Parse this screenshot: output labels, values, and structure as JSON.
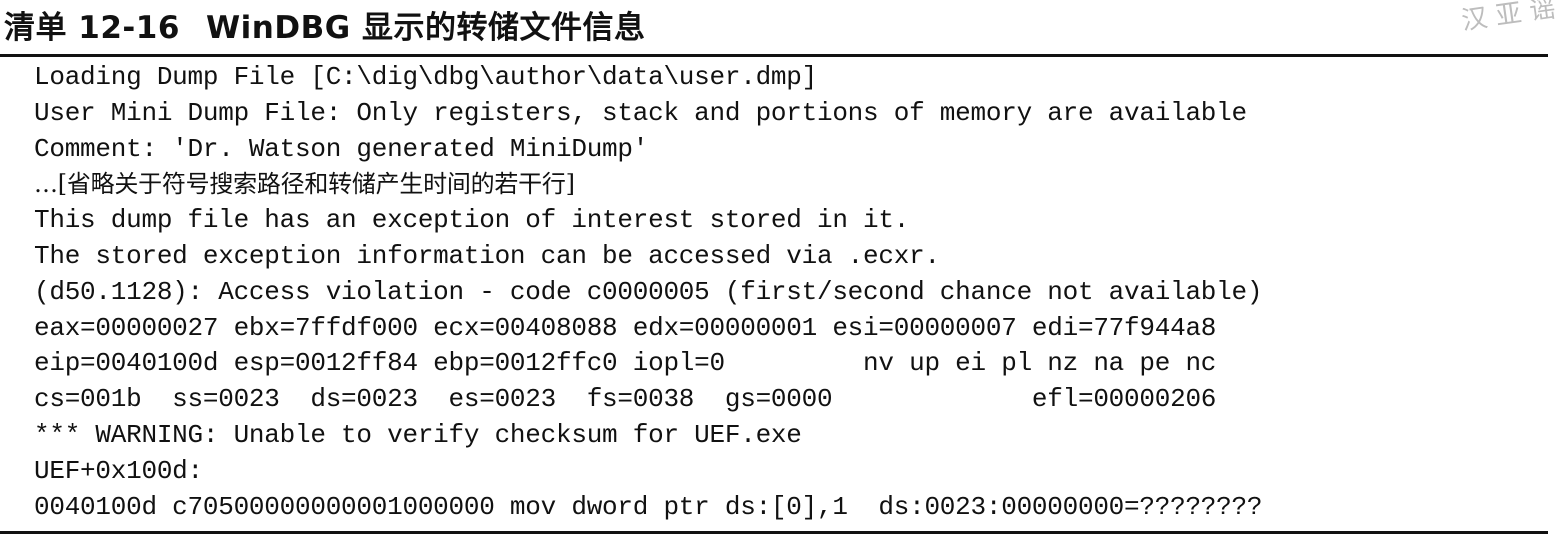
{
  "header": {
    "listing_number": "清单 12-16",
    "listing_caption": "WinDBG 显示的转储文件信息",
    "watermark": "汉 亚 谣"
  },
  "code_lines": [
    "Loading Dump File [C:\\dig\\dbg\\author\\data\\user.dmp]",
    "User Mini Dump File: Only registers, stack and portions of memory are available",
    "Comment: 'Dr. Watson generated MiniDump'",
    "…[省略关于符号搜索路径和转储产生时间的若干行]",
    "This dump file has an exception of interest stored in it.",
    "The stored exception information can be accessed via .ecxr.",
    "(d50.1128): Access violation - code c0000005 (first/second chance not available)",
    "eax=00000027 ebx=7ffdf000 ecx=00408088 edx=00000001 esi=00000007 edi=77f944a8",
    "eip=0040100d esp=0012ff84 ebp=0012ffc0 iopl=0         nv up ei pl nz na pe nc",
    "cs=001b  ss=0023  ds=0023  es=0023  fs=0038  gs=0000             efl=00000206",
    "*** WARNING: Unable to verify checksum for UEF.exe",
    "UEF+0x100d:",
    "0040100d c70500000000001000000 mov dword ptr ds:[0],1  ds:0023:00000000=????????"
  ]
}
